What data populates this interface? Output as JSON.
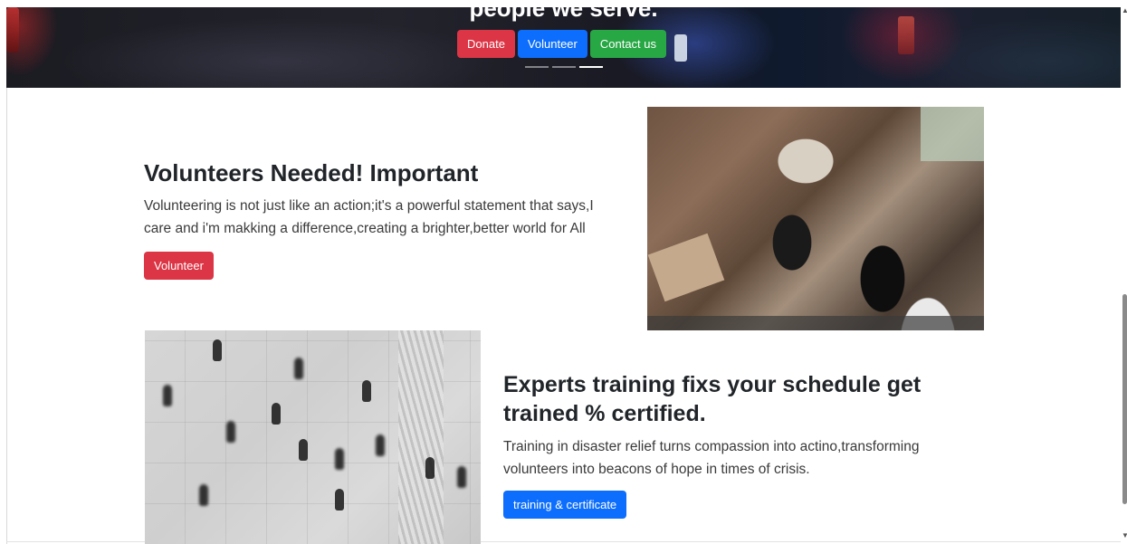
{
  "hero": {
    "heading": "people we serve.",
    "buttons": {
      "donate": "Donate",
      "volunteer": "Volunteer",
      "contact": "Contact us"
    },
    "active_slide": 3,
    "slide_count": 3
  },
  "volunteers": {
    "title": "Volunteers Needed! Important",
    "text": "Volunteering is not just like an action;it's a powerful statement that says,I care and i'm makking a difference,creating a brighter,better world for All",
    "button": "Volunteer"
  },
  "training": {
    "title": "Experts training fixs your schedule get trained % certified.",
    "text": "Training in disaster relief turns compassion into actino,transforming volunteers into beacons of hope in times of crisis.",
    "button": "training & certificate"
  },
  "icons": {
    "scroll_up": "chevron-up-icon",
    "scroll_down": "chevron-down-icon"
  },
  "colors": {
    "danger": "#dc3545",
    "primary": "#0d6efd",
    "success": "#28a745",
    "heading": "#212529"
  }
}
